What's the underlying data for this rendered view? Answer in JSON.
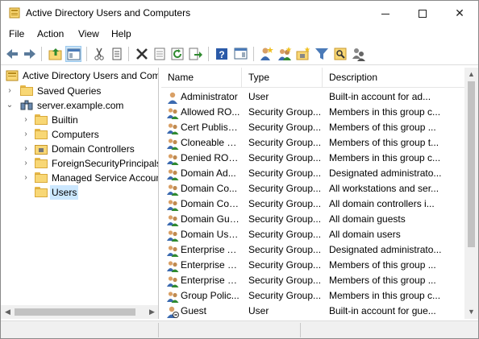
{
  "window": {
    "title": "Active Directory Users and Computers",
    "controls": {
      "minimize": "minimize",
      "maximize": "maximize",
      "close": "✕"
    }
  },
  "menu": {
    "items": [
      "File",
      "Action",
      "View",
      "Help"
    ]
  },
  "toolbar": {
    "buttons": [
      "back-arrow-icon",
      "forward-arrow-icon",
      "up-folder-icon",
      "show-console-tree-icon",
      "cut-icon",
      "copy-icon",
      "delete-icon",
      "properties-icon",
      "refresh-icon",
      "export-list-icon",
      "help-icon",
      "action-pane-icon",
      "new-user-icon",
      "new-group-icon",
      "new-ou-icon",
      "filter-icon",
      "find-icon",
      "add-to-group-icon"
    ]
  },
  "tree": {
    "root": "Active Directory Users and Computers",
    "saved_queries": "Saved Queries",
    "domain": "server.example.com",
    "children": [
      "Builtin",
      "Computers",
      "Domain Controllers",
      "ForeignSecurityPrincipals",
      "Managed Service Accounts",
      "Users"
    ],
    "selected": "Users"
  },
  "list": {
    "columns": {
      "name": "Name",
      "type": "Type",
      "description": "Description"
    },
    "rows": [
      {
        "icon": "user",
        "name": "Administrator",
        "type": "User",
        "description": "Built-in account for ad..."
      },
      {
        "icon": "group",
        "name": "Allowed RO...",
        "type": "Security Group...",
        "description": "Members in this group c..."
      },
      {
        "icon": "group",
        "name": "Cert Publish...",
        "type": "Security Group...",
        "description": "Members of this group ..."
      },
      {
        "icon": "group",
        "name": "Cloneable D...",
        "type": "Security Group...",
        "description": "Members of this group t..."
      },
      {
        "icon": "group",
        "name": "Denied ROD...",
        "type": "Security Group...",
        "description": "Members in this group c..."
      },
      {
        "icon": "group",
        "name": "Domain Ad...",
        "type": "Security Group...",
        "description": "Designated administrato..."
      },
      {
        "icon": "group",
        "name": "Domain Co...",
        "type": "Security Group...",
        "description": "All workstations and ser..."
      },
      {
        "icon": "group",
        "name": "Domain Con...",
        "type": "Security Group...",
        "description": "All domain controllers i..."
      },
      {
        "icon": "group",
        "name": "Domain Gue...",
        "type": "Security Group...",
        "description": "All domain guests"
      },
      {
        "icon": "group",
        "name": "Domain Users",
        "type": "Security Group...",
        "description": "All domain users"
      },
      {
        "icon": "group",
        "name": "Enterprise A...",
        "type": "Security Group...",
        "description": "Designated administrato..."
      },
      {
        "icon": "group",
        "name": "Enterprise K...",
        "type": "Security Group...",
        "description": "Members of this group ..."
      },
      {
        "icon": "group",
        "name": "Enterprise R...",
        "type": "Security Group...",
        "description": "Members of this group ..."
      },
      {
        "icon": "group",
        "name": "Group Polic...",
        "type": "Security Group...",
        "description": "Members in this group c..."
      },
      {
        "icon": "user-disabled",
        "name": "Guest",
        "type": "User",
        "description": "Built-in account for gue..."
      }
    ]
  },
  "colors": {
    "selection": "#cce8ff",
    "folder": "#f8d775"
  }
}
